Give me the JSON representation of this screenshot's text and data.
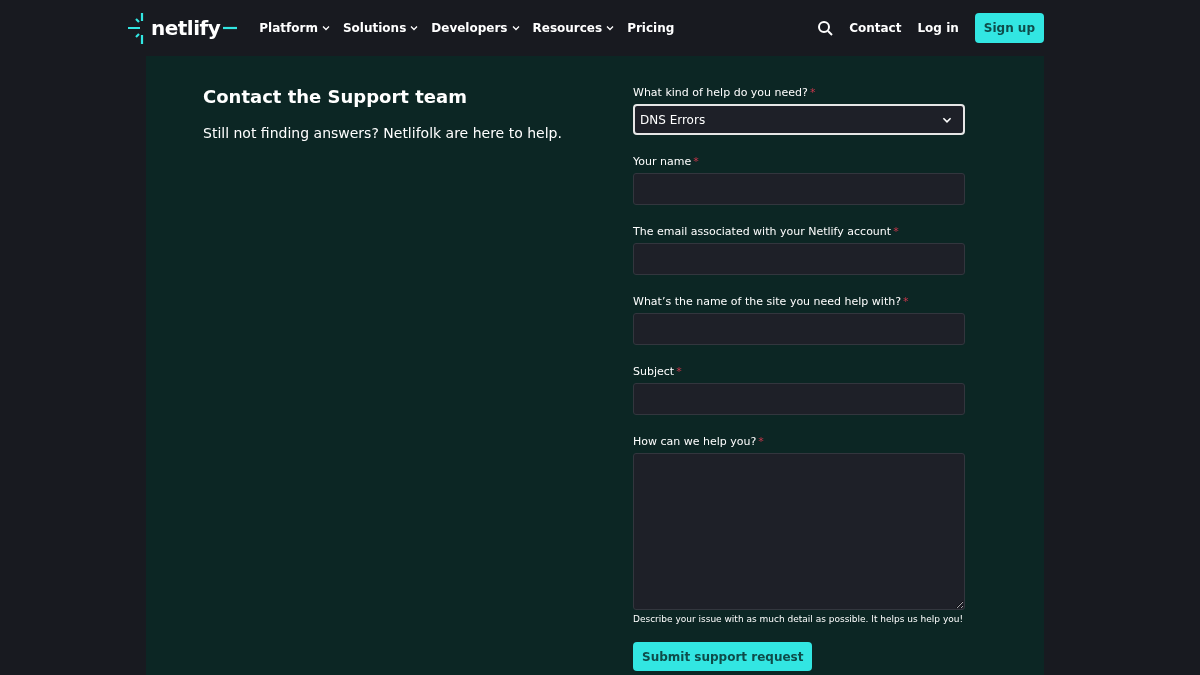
{
  "header": {
    "logo": "netlify",
    "nav": [
      {
        "label": "Platform",
        "has_menu": true
      },
      {
        "label": "Solutions",
        "has_menu": true
      },
      {
        "label": "Developers",
        "has_menu": true
      },
      {
        "label": "Resources",
        "has_menu": true
      },
      {
        "label": "Pricing",
        "has_menu": false
      }
    ],
    "contact": "Contact",
    "login": "Log in",
    "signup": "Sign up"
  },
  "intro": {
    "title": "Contact the Support team",
    "text": "Still not finding answers? Netlifolk are here to help."
  },
  "form": {
    "fields": [
      {
        "kind": "select",
        "label": "What kind of help do you need?",
        "mark": "*",
        "value": "DNS Errors"
      },
      {
        "kind": "text",
        "label": "Your name",
        "mark": "*"
      },
      {
        "kind": "text",
        "label": "The email associated with your Netlify account",
        "mark": "*"
      },
      {
        "kind": "text",
        "label": "What’s the name of the site you need help with?",
        "mark": "*"
      },
      {
        "kind": "text",
        "label": "Subject",
        "mark": "*"
      },
      {
        "kind": "textarea",
        "label": "How can we help you?",
        "mark": "*",
        "hint": "Describe your issue with as much detail as possible. It helps us help you!"
      }
    ],
    "submit": "Submit support request"
  }
}
